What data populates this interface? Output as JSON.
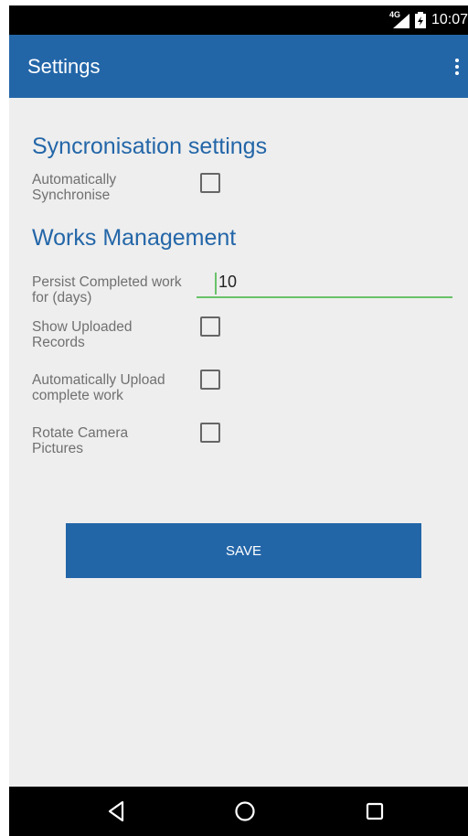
{
  "status_bar": {
    "network": "4G",
    "time": "10:07"
  },
  "app_bar": {
    "title": "Settings",
    "menu_icon": "more-vert-icon"
  },
  "sections": {
    "sync_title": "Syncronisation settings",
    "works_title": "Works Management"
  },
  "settings": {
    "auto_sync_label": "Automatically Synchronise",
    "persist_label": "Persist Completed work for (days)",
    "persist_value": "10",
    "show_uploaded_label": "Show Uploaded Records",
    "auto_upload_label": "Automatically Upload complete work",
    "rotate_camera_label": "Rotate Camera Pictures"
  },
  "checkbox_states": {
    "auto_sync": false,
    "show_uploaded": false,
    "auto_upload": false,
    "rotate_camera": false
  },
  "save_button": {
    "label": "SAVE"
  },
  "nav_bar": {
    "back_icon": "back-triangle-icon",
    "home_icon": "home-circle-icon",
    "recents_icon": "recents-square-icon"
  },
  "colors": {
    "primary": "#2366a8",
    "accent": "#69c269",
    "background": "#eeeeee"
  }
}
